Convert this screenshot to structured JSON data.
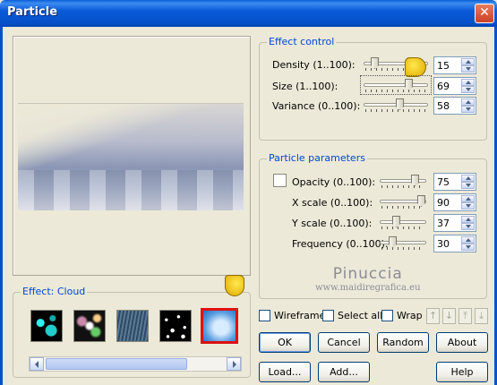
{
  "window": {
    "title": "Particle",
    "close_glyph": "✕"
  },
  "effect_control": {
    "legend": "Effect control",
    "rows": [
      {
        "label": "Density (1..100):",
        "value": "15",
        "fraction": 0.14
      },
      {
        "label": "Size (1..100):",
        "value": "69",
        "fraction": 0.69
      },
      {
        "label": "Variance (0..100):",
        "value": "58",
        "fraction": 0.58
      }
    ]
  },
  "particle_parameters": {
    "legend": "Particle parameters",
    "rows": [
      {
        "label": "Opacity (0..100):",
        "value": "75",
        "fraction": 0.75
      },
      {
        "label": "X scale (0..100):",
        "value": "90",
        "fraction": 0.9
      },
      {
        "label": "Y scale (0..100):",
        "value": "37",
        "fraction": 0.37
      },
      {
        "label": "Frequency (0..100):",
        "value": "30",
        "fraction": 0.3
      }
    ]
  },
  "effect_gallery": {
    "legend": "Effect: Cloud",
    "thumbnails": [
      "bubbles",
      "sparkles",
      "rain",
      "snow",
      "cloud"
    ],
    "selected": "cloud"
  },
  "watermark": {
    "line1": "Pinuccia",
    "line2": "www.maidiregrafica.eu"
  },
  "options": {
    "wireframe": "Wireframe",
    "select_all": "Select all",
    "wrap": "Wrap"
  },
  "buttons": {
    "ok": "OK",
    "cancel": "Cancel",
    "random": "Random",
    "about": "About",
    "load": "Load...",
    "add": "Add...",
    "help": "Help"
  },
  "icons": {
    "pointer": "hand-pointer-icon",
    "move_up": "arrow-up-icon",
    "move_down": "arrow-down-icon",
    "move_top": "arrow-top-icon",
    "move_bottom": "arrow-bottom-icon"
  }
}
